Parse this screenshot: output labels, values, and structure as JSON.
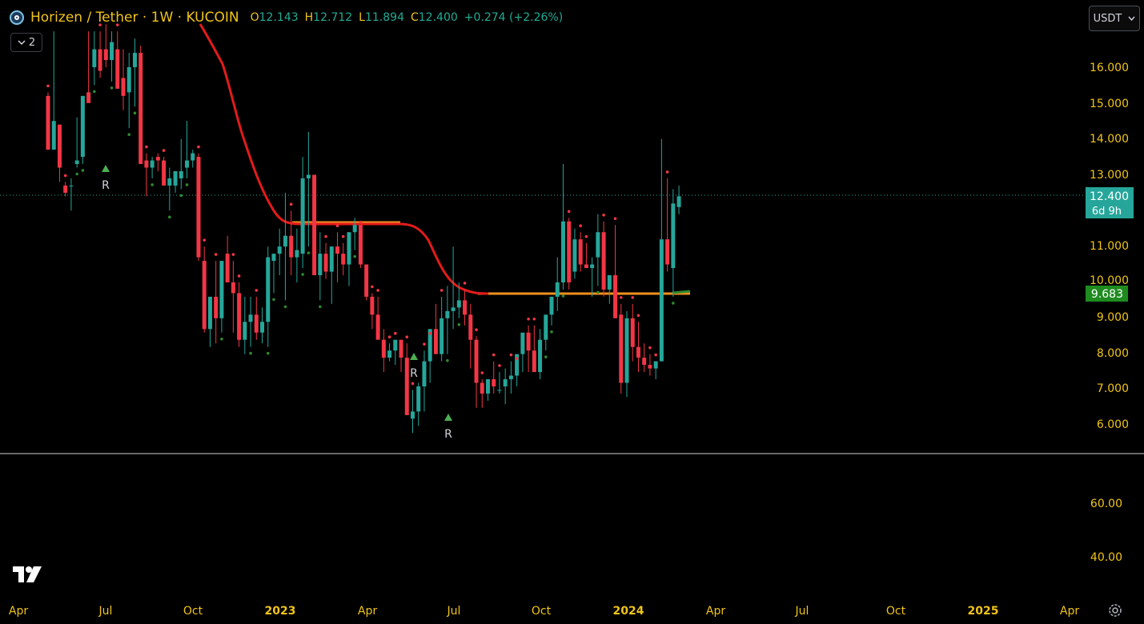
{
  "header": {
    "symbol": "Horizen / Tether · 1W · KUCOIN",
    "open_label": "O",
    "open": "12.143",
    "high_label": "H",
    "high": "12.712",
    "low_label": "L",
    "low": "11.894",
    "close_label": "C",
    "close": "12.400",
    "change": "+0.274 (+2.26%)"
  },
  "collapse_count": "2",
  "currency": "USDT",
  "price_badge": {
    "price": "12.400",
    "countdown": "6d 9h"
  },
  "indicator_badge": "9.683",
  "price_axis": [
    "16.000",
    "15.000",
    "14.000",
    "13.000",
    "11.000",
    "10.000",
    "9.000",
    "8.000",
    "7.000",
    "6.000"
  ],
  "osc_axis": [
    "60.00",
    "40.00"
  ],
  "time_axis": [
    "Apr",
    "Jul",
    "Oct",
    "2023",
    "Apr",
    "Jul",
    "Oct",
    "2024",
    "Apr",
    "Jul",
    "Oct",
    "2025",
    "Apr"
  ],
  "markers": [
    "R",
    "R",
    "R"
  ],
  "colors": {
    "up": "#26a69a",
    "down": "#f23645",
    "ma": "#e31b1b",
    "level": "#f0901e",
    "text": "#f0c419"
  },
  "chart_data": {
    "type": "candlestick",
    "ylim": [
      5.5,
      16.5
    ],
    "candles": [
      [
        15.2,
        15.3,
        13.7,
        13.7
      ],
      [
        13.7,
        17.0,
        13.8,
        14.5
      ],
      [
        14.4,
        14.0,
        12.8,
        13.2
      ],
      [
        12.7,
        12.8,
        12.4,
        12.5
      ],
      [
        12.7,
        12.9,
        12.0,
        12.7
      ],
      [
        13.3,
        14.6,
        13.2,
        13.4
      ],
      [
        13.5,
        15.0,
        13.3,
        15.2
      ],
      [
        15.3,
        17.0,
        15.2,
        15.0
      ],
      [
        16.0,
        17.0,
        15.5,
        16.5
      ],
      [
        16.5,
        17.0,
        15.7,
        15.9
      ],
      [
        16.5,
        17.2,
        16.0,
        16.2
      ],
      [
        16.2,
        17.0,
        15.6,
        16.7
      ],
      [
        16.5,
        17.0,
        15.7,
        15.4
      ],
      [
        15.7,
        16.5,
        14.8,
        15.2
      ],
      [
        15.3,
        16.4,
        14.3,
        16.0
      ],
      [
        16.0,
        16.8,
        14.9,
        16.4
      ],
      [
        16.4,
        16.6,
        14.5,
        13.3
      ],
      [
        13.4,
        13.6,
        12.4,
        13.2
      ],
      [
        13.2,
        13.5,
        12.9,
        13.4
      ],
      [
        13.5,
        13.6,
        13.1,
        13.4
      ],
      [
        13.4,
        13.5,
        12.7,
        12.7
      ],
      [
        12.7,
        13.2,
        12.0,
        12.9
      ],
      [
        12.7,
        13.0,
        12.5,
        13.1
      ],
      [
        12.9,
        14.0,
        12.6,
        13.1
      ],
      [
        13.2,
        14.5,
        12.9,
        13.4
      ],
      [
        13.4,
        13.7,
        13.2,
        13.6
      ],
      [
        13.5,
        13.6,
        10.6,
        10.7
      ],
      [
        10.6,
        11.0,
        8.6,
        8.7
      ],
      [
        8.7,
        9.6,
        8.2,
        9.6
      ],
      [
        9.6,
        10.6,
        8.3,
        9.0
      ],
      [
        9.0,
        10.2,
        8.6,
        10.6
      ],
      [
        10.8,
        11.3,
        10.5,
        10.0
      ],
      [
        10.0,
        10.6,
        8.6,
        9.7
      ],
      [
        9.7,
        10.0,
        8.2,
        8.4
      ],
      [
        8.4,
        9.6,
        8.0,
        8.9
      ],
      [
        8.9,
        9.6,
        8.2,
        9.1
      ],
      [
        9.1,
        9.6,
        8.4,
        8.6
      ],
      [
        8.6,
        9.3,
        8.3,
        8.9
      ],
      [
        8.9,
        11.0,
        8.2,
        10.7
      ],
      [
        10.6,
        10.8,
        9.7,
        10.8
      ],
      [
        10.8,
        11.5,
        10.2,
        11.0
      ],
      [
        11.0,
        12.5,
        9.5,
        11.3
      ],
      [
        11.3,
        12.0,
        10.2,
        10.7
      ],
      [
        10.7,
        11.5,
        10.0,
        10.9
      ],
      [
        10.8,
        13.5,
        10.4,
        12.9
      ],
      [
        12.9,
        14.2,
        11.0,
        13.0
      ],
      [
        13.0,
        13.0,
        10.2,
        10.2
      ],
      [
        10.2,
        11.4,
        9.5,
        10.8
      ],
      [
        10.8,
        11.1,
        10.1,
        10.3
      ],
      [
        10.3,
        11.0,
        9.4,
        11.0
      ],
      [
        11.0,
        11.4,
        10.0,
        10.8
      ],
      [
        10.8,
        11.1,
        10.2,
        10.5
      ],
      [
        10.5,
        11.3,
        9.9,
        11.4
      ],
      [
        11.4,
        11.8,
        10.9,
        11.6
      ],
      [
        11.6,
        11.5,
        10.4,
        10.5
      ],
      [
        10.5,
        10.5,
        9.5,
        9.6
      ],
      [
        9.6,
        9.7,
        8.7,
        9.1
      ],
      [
        9.1,
        9.6,
        8.6,
        8.4
      ],
      [
        8.4,
        8.7,
        7.5,
        7.9
      ],
      [
        7.9,
        8.3,
        7.8,
        8.1
      ],
      [
        8.1,
        8.4,
        7.7,
        8.4
      ],
      [
        8.4,
        8.4,
        7.5,
        7.9
      ],
      [
        7.9,
        8.3,
        6.3,
        6.3
      ],
      [
        6.2,
        7.0,
        5.8,
        6.4
      ],
      [
        6.4,
        7.2,
        6.0,
        7.1
      ],
      [
        7.1,
        8.1,
        6.4,
        7.8
      ],
      [
        7.8,
        8.4,
        7.2,
        8.7
      ],
      [
        8.7,
        9.4,
        8.0,
        8.0
      ],
      [
        8.0,
        9.6,
        7.8,
        9.0
      ],
      [
        9.0,
        9.9,
        8.0,
        9.2
      ],
      [
        9.2,
        11.0,
        8.7,
        9.3
      ],
      [
        9.3,
        10.0,
        9.0,
        9.5
      ],
      [
        9.5,
        9.8,
        8.8,
        9.1
      ],
      [
        9.1,
        9.4,
        7.6,
        8.4
      ],
      [
        8.4,
        8.5,
        6.5,
        7.2
      ],
      [
        7.2,
        7.3,
        6.5,
        6.9
      ],
      [
        6.9,
        7.3,
        6.7,
        7.3
      ],
      [
        7.3,
        7.8,
        6.9,
        7.1
      ],
      [
        7.0,
        7.5,
        6.9,
        7.0
      ],
      [
        7.1,
        7.6,
        6.6,
        7.3
      ],
      [
        7.3,
        7.8,
        6.9,
        7.4
      ],
      [
        7.4,
        7.7,
        7.1,
        8.0
      ],
      [
        8.0,
        8.4,
        7.5,
        8.6
      ],
      [
        8.6,
        8.8,
        7.5,
        8.1
      ],
      [
        8.1,
        8.8,
        7.6,
        7.5
      ],
      [
        7.5,
        8.7,
        7.3,
        8.4
      ],
      [
        8.4,
        8.8,
        8.1,
        9.1
      ],
      [
        9.1,
        9.6,
        8.8,
        9.6
      ],
      [
        9.6,
        10.7,
        9.2,
        10.0
      ],
      [
        10.0,
        13.3,
        9.8,
        11.7
      ],
      [
        11.7,
        11.8,
        9.8,
        10.0
      ],
      [
        10.3,
        11.5,
        10.1,
        11.2
      ],
      [
        11.2,
        11.4,
        10.3,
        10.5
      ],
      [
        10.5,
        11.1,
        10.4,
        10.4
      ],
      [
        10.4,
        10.7,
        9.6,
        10.5
      ],
      [
        10.7,
        11.9,
        9.9,
        11.4
      ],
      [
        11.4,
        11.7,
        9.6,
        9.8
      ],
      [
        9.8,
        10.2,
        9.4,
        10.2
      ],
      [
        10.2,
        11.6,
        9.2,
        9.0
      ],
      [
        9.1,
        9.4,
        6.9,
        7.2
      ],
      [
        7.2,
        9.2,
        6.8,
        9.0
      ],
      [
        9.0,
        9.4,
        7.8,
        8.2
      ],
      [
        8.2,
        8.9,
        7.5,
        7.9
      ],
      [
        7.9,
        8.3,
        7.5,
        7.7
      ],
      [
        7.7,
        8.0,
        7.4,
        7.6
      ],
      [
        7.6,
        7.8,
        7.3,
        7.8
      ],
      [
        7.8,
        14.0,
        7.8,
        11.2
      ],
      [
        11.2,
        12.9,
        10.3,
        10.5
      ],
      [
        10.4,
        12.6,
        9.6,
        12.2
      ],
      [
        12.1,
        12.7,
        11.9,
        12.4
      ]
    ]
  }
}
